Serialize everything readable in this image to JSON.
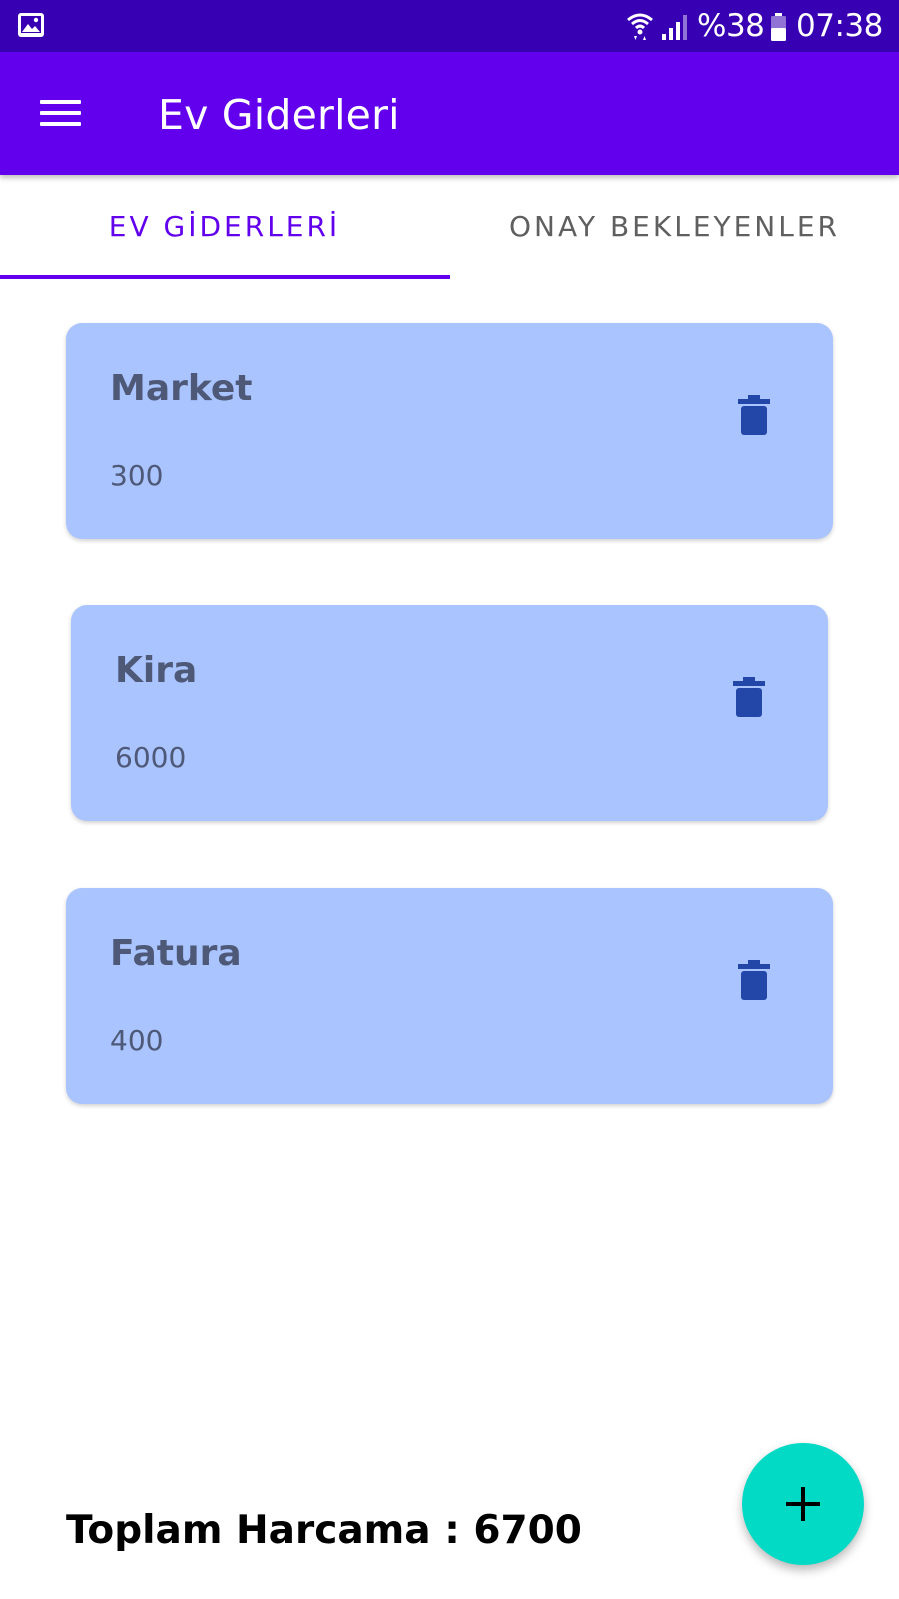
{
  "status_bar": {
    "battery": "%38",
    "time": "07:38",
    "icons": [
      "gallery-icon",
      "wifi-icon",
      "signal-icon",
      "battery-icon"
    ]
  },
  "app_bar": {
    "title": "Ev Giderleri",
    "menu_icon": "hamburger-menu-icon"
  },
  "tabs": [
    {
      "label": "EV GİDERLERİ",
      "active": true
    },
    {
      "label": "ONAY BEKLEYENLER",
      "active": false
    }
  ],
  "expenses": [
    {
      "name": "Market",
      "amount": "300"
    },
    {
      "name": "Kira",
      "amount": "6000"
    },
    {
      "name": "Fatura",
      "amount": "400"
    }
  ],
  "total_text": "Toplam Harcama : 6700",
  "fab_icon": "plus-icon",
  "colors": {
    "status_bar": "#3700b3",
    "app_bar": "#6200ee",
    "card": "#aac4ff",
    "delete_icon": "#2346a9",
    "fab": "#03dac5"
  }
}
